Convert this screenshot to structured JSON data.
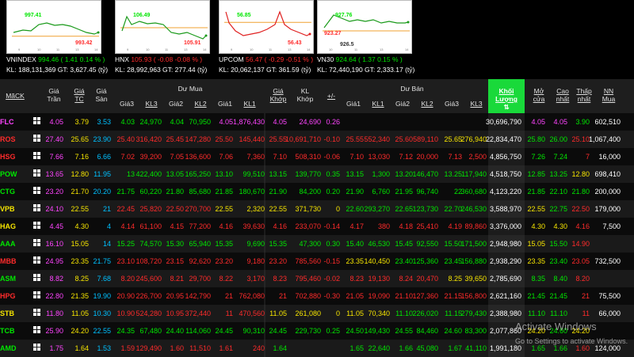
{
  "indices": [
    {
      "name": "VNINDEX",
      "price": "994.46",
      "chg": "1.41",
      "pct": "0.14 %",
      "kl": "188,131,369",
      "gt": "3,627.45",
      "unit": "(tỷ)",
      "hi": "997.41",
      "lo": "993.42",
      "x_ticks": [
        "9",
        "10",
        "11",
        "13",
        "14"
      ]
    },
    {
      "name": "HNX",
      "price": "105.93",
      "chg": "-0.08",
      "pct": "-0.08 %",
      "kl": "28,992,963",
      "gt": "277.44",
      "unit": "(tỷ)",
      "hi": "106.49",
      "lo": "105.91",
      "x_ticks": [
        "9",
        "10",
        "11",
        "13",
        "14"
      ]
    },
    {
      "name": "UPCOM",
      "price": "56.47",
      "chg": "-0.29",
      "pct": "-0.51 %",
      "kl": "20,062,137",
      "gt": "361.59",
      "unit": "(tỷ)",
      "hi": "56.85",
      "lo": "56.43",
      "x_ticks": [
        "9",
        "10",
        "11",
        "13",
        "14"
      ]
    },
    {
      "name": "VN30",
      "price": "924.64",
      "chg": "1.37",
      "pct": "0.15 %",
      "kl": "72,440,190",
      "gt": "2,333.17",
      "unit": "(tỷ)",
      "hi": "927.76",
      "lo": "923.27",
      "lo2": "926.5",
      "x_ticks": [
        "10",
        "11",
        "13",
        "14"
      ]
    }
  ],
  "labels": {
    "kl": "KL:",
    "gt": "GT:"
  },
  "header": {
    "mack": "MãCK",
    "gia_tran": "Giá Trần",
    "gia_tc": "Giá TC",
    "gia_san": "Giá Sàn",
    "du_mua": "Dư Mua",
    "du_ban": "Dư Bán",
    "gia3": "Giá3",
    "kl3": "KL3",
    "gia2": "Giá2",
    "kl2": "KL2",
    "gia1": "Giá1",
    "kl1": "KL1",
    "gia_khop": "Giá Khớp",
    "kl_khop": "KL Khớp",
    "change": "+/-",
    "khoi_luong": "Khối Lượng",
    "mo_cua": "Mở cửa",
    "cao_nhat": "Cao nhất",
    "thap_nhat": "Thấp nhất",
    "nn_mua": "NN Mua"
  },
  "rows": [
    {
      "sym": "FLC",
      "c": "m",
      "tran": "4.05",
      "tc": "3.79",
      "san": "3.53",
      "b3": [
        "4.03",
        "24,970",
        "g"
      ],
      "b2": [
        "4.04",
        "70,950",
        "g"
      ],
      "b1": [
        "4.05",
        "1,876,430",
        "m"
      ],
      "kh": [
        "4.05",
        "24,690",
        "0.26",
        "m"
      ],
      "s1": [
        "",
        "",
        ""
      ],
      "s2": [
        "",
        "",
        ""
      ],
      "s3": [
        "",
        "",
        ""
      ],
      "kl": "30,696,790",
      "mo": [
        "4.05",
        "m"
      ],
      "cao": [
        "4.05",
        "m"
      ],
      "thap": [
        "3.90",
        "g"
      ],
      "nn": "602,510"
    },
    {
      "sym": "ROS",
      "c": "r",
      "tran": "27.40",
      "tc": "25.65",
      "san": "23.90",
      "b3": [
        "25.40",
        "316,420",
        "r"
      ],
      "b2": [
        "25.45",
        "147,280",
        "r"
      ],
      "b1": [
        "25.50",
        "145,440",
        "r"
      ],
      "kh": [
        "25.55",
        "10,691,710",
        "-0.10",
        "r"
      ],
      "s1": [
        "25.55",
        "552,340",
        "r"
      ],
      "s2": [
        "25.60",
        "589,110",
        "r"
      ],
      "s3": [
        "25.65",
        "276,940",
        "y"
      ],
      "kl": "22,834,470",
      "mo": [
        "25.80",
        "g"
      ],
      "cao": [
        "26.00",
        "g"
      ],
      "thap": [
        "25.10",
        "r"
      ],
      "nn": "1,067,400"
    },
    {
      "sym": "HSG",
      "c": "r",
      "tran": "7.66",
      "tc": "7.16",
      "san": "6.66",
      "b3": [
        "7.02",
        "39,200",
        "r"
      ],
      "b2": [
        "7.05",
        "136,600",
        "r"
      ],
      "b1": [
        "7.06",
        "7,360",
        "r"
      ],
      "kh": [
        "7.10",
        "508,310",
        "-0.06",
        "r"
      ],
      "s1": [
        "7.10",
        "13,030",
        "r"
      ],
      "s2": [
        "7.12",
        "20,000",
        "r"
      ],
      "s3": [
        "7.13",
        "2,500",
        "r"
      ],
      "kl": "4,856,750",
      "mo": [
        "7.26",
        "g"
      ],
      "cao": [
        "7.24",
        "g"
      ],
      "thap": [
        "7",
        "r"
      ],
      "nn": "16,000"
    },
    {
      "sym": "POW",
      "c": "g",
      "tran": "13.65",
      "tc": "12.80",
      "san": "11.95",
      "b3": [
        "13",
        "422,400",
        "g"
      ],
      "b2": [
        "13.05",
        "165,250",
        "g"
      ],
      "b1": [
        "13.10",
        "99,510",
        "g"
      ],
      "kh": [
        "13.15",
        "139,770",
        "0.35",
        "g"
      ],
      "s1": [
        "13.15",
        "1,300",
        "g"
      ],
      "s2": [
        "13.20",
        "146,470",
        "g"
      ],
      "s3": [
        "13.25",
        "117,940",
        "g"
      ],
      "kl": "4,518,750",
      "mo": [
        "12.85",
        "g"
      ],
      "cao": [
        "13.25",
        "g"
      ],
      "thap": [
        "12.80",
        "y"
      ],
      "nn": "698,410"
    },
    {
      "sym": "CTG",
      "c": "g",
      "tran": "23.20",
      "tc": "21.70",
      "san": "20.20",
      "b3": [
        "21.75",
        "60,220",
        "g"
      ],
      "b2": [
        "21.80",
        "85,680",
        "g"
      ],
      "b1": [
        "21.85",
        "180,670",
        "g"
      ],
      "kh": [
        "21.90",
        "84,200",
        "0.20",
        "g"
      ],
      "s1": [
        "21.90",
        "6,760",
        "g"
      ],
      "s2": [
        "21.95",
        "96,740",
        "g"
      ],
      "s3": [
        "22",
        "360,680",
        "g"
      ],
      "kl": "4,123,220",
      "mo": [
        "21.85",
        "g"
      ],
      "cao": [
        "22.10",
        "g"
      ],
      "thap": [
        "21.80",
        "g"
      ],
      "nn": "200,000"
    },
    {
      "sym": "VPB",
      "c": "y",
      "tran": "24.10",
      "tc": "22.55",
      "san": "21",
      "b3": [
        "22.45",
        "25,820",
        "r"
      ],
      "b2": [
        "22.50",
        "270,700",
        "r"
      ],
      "b1": [
        "22.55",
        "2,320",
        "y"
      ],
      "kh": [
        "22.55",
        "371,730",
        "0",
        "y"
      ],
      "s1": [
        "22.60",
        "293,270",
        "g"
      ],
      "s2": [
        "22.65",
        "123,730",
        "g"
      ],
      "s3": [
        "22.70",
        "246,530",
        "g"
      ],
      "kl": "3,588,970",
      "mo": [
        "22.55",
        "y"
      ],
      "cao": [
        "22.75",
        "g"
      ],
      "thap": [
        "22.50",
        "r"
      ],
      "nn": "179,000"
    },
    {
      "sym": "HAG",
      "c": "y",
      "tran": "4.45",
      "tc": "4.30",
      "san": "4",
      "b3": [
        "4.14",
        "61,100",
        "r"
      ],
      "b2": [
        "4.15",
        "77,200",
        "r"
      ],
      "b1": [
        "4.16",
        "39,630",
        "r"
      ],
      "kh": [
        "4.16",
        "233,070",
        "-0.14",
        "r"
      ],
      "s1": [
        "4.17",
        "380",
        "r"
      ],
      "s2": [
        "4.18",
        "25,410",
        "r"
      ],
      "s3": [
        "4.19",
        "89,860",
        "r"
      ],
      "kl": "3,376,000",
      "mo": [
        "4.30",
        "y"
      ],
      "cao": [
        "4.30",
        "y"
      ],
      "thap": [
        "4.16",
        "r"
      ],
      "nn": "7,500"
    },
    {
      "sym": "AAA",
      "c": "g",
      "tran": "16.10",
      "tc": "15.05",
      "san": "14",
      "b3": [
        "15.25",
        "74,570",
        "g"
      ],
      "b2": [
        "15.30",
        "65,940",
        "g"
      ],
      "b1": [
        "15.35",
        "9,690",
        "g"
      ],
      "kh": [
        "15.35",
        "47,300",
        "0.30",
        "g"
      ],
      "s1": [
        "15.40",
        "46,530",
        "g"
      ],
      "s2": [
        "15.45",
        "92,550",
        "g"
      ],
      "s3": [
        "15.50",
        "171,500",
        "g"
      ],
      "kl": "2,948,980",
      "mo": [
        "15.05",
        "y"
      ],
      "cao": [
        "15.50",
        "g"
      ],
      "thap": [
        "14.90",
        "r"
      ],
      "nn": ""
    },
    {
      "sym": "MBB",
      "c": "r",
      "tran": "24.95",
      "tc": "23.35",
      "san": "21.75",
      "b3": [
        "23.10",
        "108,720",
        "r"
      ],
      "b2": [
        "23.15",
        "92,620",
        "r"
      ],
      "b1": [
        "23.20",
        "9,180",
        "r"
      ],
      "kh": [
        "23.20",
        "785,560",
        "-0.15",
        "r"
      ],
      "s1": [
        "23.35",
        "140,450",
        "y"
      ],
      "s2": [
        "23.40",
        "125,360",
        "g"
      ],
      "s3": [
        "23.45",
        "156,880",
        "g"
      ],
      "kl": "2,938,290",
      "mo": [
        "23.35",
        "y"
      ],
      "cao": [
        "23.40",
        "g"
      ],
      "thap": [
        "23.05",
        "r"
      ],
      "nn": "732,500"
    },
    {
      "sym": "ASM",
      "c": "g",
      "tran": "8.82",
      "tc": "8.25",
      "san": "7.68",
      "b3": [
        "8.20",
        "245,600",
        "r"
      ],
      "b2": [
        "8.21",
        "29,700",
        "r"
      ],
      "b1": [
        "8.22",
        "3,170",
        "r"
      ],
      "kh": [
        "8.23",
        "795,460",
        "-0.02",
        "r"
      ],
      "s1": [
        "8.23",
        "19,130",
        "r"
      ],
      "s2": [
        "8.24",
        "20,470",
        "r"
      ],
      "s3": [
        "8.25",
        "39,650",
        "y"
      ],
      "kl": "2,785,690",
      "mo": [
        "8.35",
        "g"
      ],
      "cao": [
        "8.40",
        "g"
      ],
      "thap": [
        "8.20",
        "r"
      ],
      "nn": ""
    },
    {
      "sym": "HPG",
      "c": "r",
      "tran": "22.80",
      "tc": "21.35",
      "san": "19.90",
      "b3": [
        "20.90",
        "226,700",
        "r"
      ],
      "b2": [
        "20.95",
        "142,790",
        "r"
      ],
      "b1": [
        "21",
        "762,080",
        "r"
      ],
      "kh": [
        "21",
        "702,880",
        "-0.30",
        "r"
      ],
      "s1": [
        "21.05",
        "19,090",
        "r"
      ],
      "s2": [
        "21.10",
        "127,360",
        "r"
      ],
      "s3": [
        "21.15",
        "156,800",
        "r"
      ],
      "kl": "2,621,160",
      "mo": [
        "21.45",
        "g"
      ],
      "cao": [
        "21.45",
        "g"
      ],
      "thap": [
        "21",
        "r"
      ],
      "nn": "75,500"
    },
    {
      "sym": "STB",
      "c": "y",
      "tran": "11.80",
      "tc": "11.05",
      "san": "10.30",
      "b3": [
        "10.90",
        "524,280",
        "r"
      ],
      "b2": [
        "10.95",
        "372,440",
        "r"
      ],
      "b1": [
        "11",
        "470,560",
        "r"
      ],
      "kh": [
        "11.05",
        "261,080",
        "0",
        "y"
      ],
      "s1": [
        "11.05",
        "70,340",
        "y"
      ],
      "s2": [
        "11.10",
        "226,020",
        "g"
      ],
      "s3": [
        "11.15",
        "279,430",
        "g"
      ],
      "kl": "2,388,980",
      "mo": [
        "11.10",
        "g"
      ],
      "cao": [
        "11.10",
        "g"
      ],
      "thap": [
        "11",
        "r"
      ],
      "nn": "66,000"
    },
    {
      "sym": "TCB",
      "c": "g",
      "tran": "25.90",
      "tc": "24.20",
      "san": "22.55",
      "b3": [
        "24.35",
        "67,480",
        "g"
      ],
      "b2": [
        "24.40",
        "114,060",
        "g"
      ],
      "b1": [
        "24.45",
        "90,310",
        "g"
      ],
      "kh": [
        "24.45",
        "229,730",
        "0.25",
        "g"
      ],
      "s1": [
        "24.50",
        "149,430",
        "g"
      ],
      "s2": [
        "24.55",
        "84,460",
        "g"
      ],
      "s3": [
        "24.60",
        "83,300",
        "g"
      ],
      "kl": "2,077,860",
      "mo": [
        "24.20",
        "y"
      ],
      "cao": [
        "24.60",
        "g"
      ],
      "thap": [
        "24.20",
        "y"
      ],
      "nn": ""
    },
    {
      "sym": "AMD",
      "c": "g",
      "tran": "1.75",
      "tc": "1.64",
      "san": "1.53",
      "b3": [
        "1.59",
        "129,490",
        "r"
      ],
      "b2": [
        "1.60",
        "11,510",
        "r"
      ],
      "b1": [
        "1.61",
        "240",
        "r"
      ],
      "kh": [
        "1.64",
        "",
        "",
        "g"
      ],
      "s1": [
        "1.65",
        "22,640",
        "g"
      ],
      "s2": [
        "1.66",
        "45,080",
        "g"
      ],
      "s3": [
        "1.67",
        "41,110",
        "g"
      ],
      "kl": "1,991,180",
      "mo": [
        "1.65",
        "g"
      ],
      "cao": [
        "1.66",
        "g"
      ],
      "thap": [
        "1.60",
        "r"
      ],
      "nn": "124,000"
    }
  ],
  "watermark": {
    "title": "Activate Windows",
    "sub": "Go to Settings to activate Windows."
  },
  "colors": {
    "g": "#00e600",
    "r": "#ff2b2b",
    "y": "#f5e400",
    "c": "#00c0ff",
    "m": "#ff44ff"
  }
}
